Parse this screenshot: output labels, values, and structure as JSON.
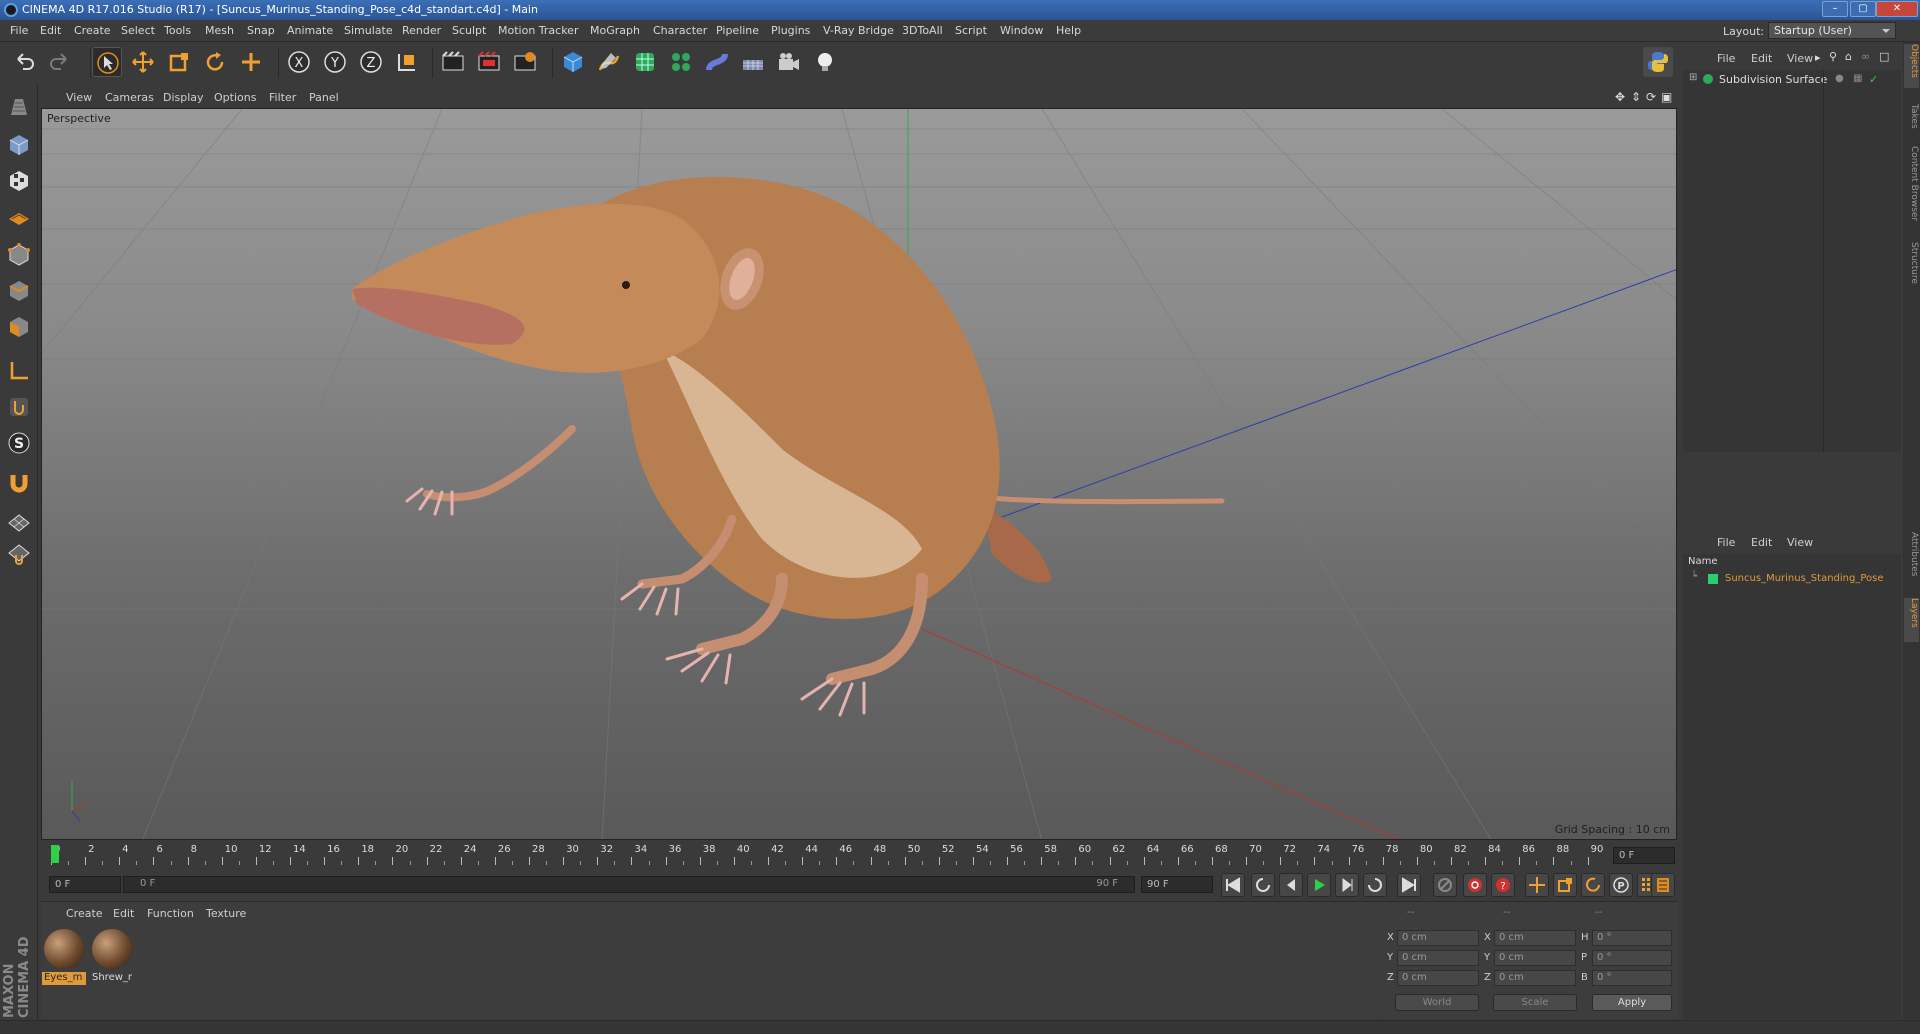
{
  "window": {
    "title": "CINEMA 4D R17.016 Studio (R17) - [Suncus_Murinus_Standing_Pose_c4d_standart.c4d] - Main",
    "min_icon": "minimize-icon",
    "max_icon": "maximize-icon",
    "close_icon": "close-icon"
  },
  "menu": [
    "File",
    "Edit",
    "Create",
    "Select",
    "Tools",
    "Mesh",
    "Snap",
    "Animate",
    "Simulate",
    "Render",
    "Sculpt",
    "Motion Tracker",
    "MoGraph",
    "Character",
    "Pipeline",
    "Plugins",
    "V-Ray Bridge",
    "3DToAll",
    "Script",
    "Window",
    "Help"
  ],
  "layout": {
    "label": "Layout:",
    "value": "Startup (User)"
  },
  "toolbar": {
    "icons": [
      "undo-icon",
      "redo-icon",
      "select-arrow-icon",
      "move-icon",
      "scale-icon",
      "rotate-icon",
      "add-icon",
      "x-axis-icon",
      "y-axis-icon",
      "z-axis-icon",
      "world-coordinates-icon",
      "render-view-icon",
      "render-picture-viewer-icon",
      "render-settings-icon",
      "cube-icon",
      "pen-spline-icon",
      "subdivision-icon",
      "array-icon",
      "deformer-icon",
      "floor-icon",
      "camera-icon",
      "light-icon",
      "python-icon"
    ]
  },
  "left_tools": [
    "model-mode-icon",
    "object-mode-icon",
    "texture-mode-icon",
    "workplane-icon",
    "points-mode-icon",
    "edges-mode-icon",
    "polygons-mode-icon",
    "axis-icon",
    "tweak-icon",
    "solo-icon",
    "magnet-icon",
    "snap-grid-icon",
    "snap-enable-icon"
  ],
  "viewport": {
    "menu": [
      "View",
      "Cameras",
      "Display",
      "Options",
      "Filter",
      "Panel"
    ],
    "label": "Perspective",
    "grid_spacing": "Grid Spacing : 10 cm",
    "nav_icons": [
      "pan-icon",
      "dolly-icon",
      "orbit-icon",
      "maximize-view-icon"
    ]
  },
  "timeline": {
    "ticks": [
      "0",
      "2",
      "4",
      "6",
      "8",
      "10",
      "12",
      "14",
      "16",
      "18",
      "20",
      "22",
      "24",
      "26",
      "28",
      "30",
      "32",
      "34",
      "36",
      "38",
      "40",
      "42",
      "44",
      "46",
      "48",
      "50",
      "52",
      "54",
      "56",
      "58",
      "60",
      "62",
      "64",
      "66",
      "68",
      "70",
      "72",
      "74",
      "76",
      "78",
      "80",
      "82",
      "84",
      "86",
      "88",
      "90"
    ],
    "current_frame": "0 F",
    "start_field": "0 F",
    "range_start": "0 F",
    "range_end": "90 F",
    "end_field": "90 F"
  },
  "transport_icons": [
    "go-to-start-icon",
    "previous-key-icon",
    "step-back-icon",
    "play-icon",
    "step-forward-icon",
    "next-key-icon",
    "go-to-end-icon",
    "record-icon",
    "autokey-icon",
    "keyframe-selection-icon",
    "move-key-icon",
    "scale-key-icon",
    "rotate-key-icon",
    "param-key-icon",
    "pla-key-icon",
    "timeline-window-icon"
  ],
  "materials": {
    "menu": [
      "Create",
      "Edit",
      "Function",
      "Texture"
    ],
    "items": [
      {
        "name": "Eyes_m",
        "selected": true
      },
      {
        "name": "Shrew_r",
        "selected": false
      }
    ]
  },
  "coordinates": {
    "header": [
      "--",
      "--",
      "--"
    ],
    "rows": [
      {
        "l1": "X",
        "v1": "0 cm",
        "l2": "X",
        "v2": "0 cm",
        "l3": "H",
        "v3": "0 °"
      },
      {
        "l1": "Y",
        "v1": "0 cm",
        "l2": "Y",
        "v2": "0 cm",
        "l3": "P",
        "v3": "0 °"
      },
      {
        "l1": "Z",
        "v1": "0 cm",
        "l2": "Z",
        "v2": "0 cm",
        "l3": "B",
        "v3": "0 °"
      }
    ],
    "mode": "World",
    "transform": "Scale",
    "apply": "Apply"
  },
  "objects": {
    "menu": [
      "File",
      "Edit",
      "View"
    ],
    "items": [
      {
        "name": "Subdivision Surface"
      }
    ]
  },
  "layers": {
    "menu": [
      "File",
      "Edit",
      "View"
    ],
    "column": "Name",
    "items": [
      {
        "name": "Suncus_Murinus_Standing_Pose",
        "color": "#2ecc71"
      }
    ]
  },
  "right_tabs": [
    "Objects",
    "Takes",
    "Content Browser",
    "Structure",
    "Attributes",
    "Layers"
  ],
  "branding": "MAXON CINEMA 4D",
  "colors": {
    "accent": "#e09a3a",
    "title_bar": "#2f5ea3",
    "x_axis": "#c0392b",
    "y_axis": "#27ae60",
    "z_axis": "#2c3ea8"
  }
}
